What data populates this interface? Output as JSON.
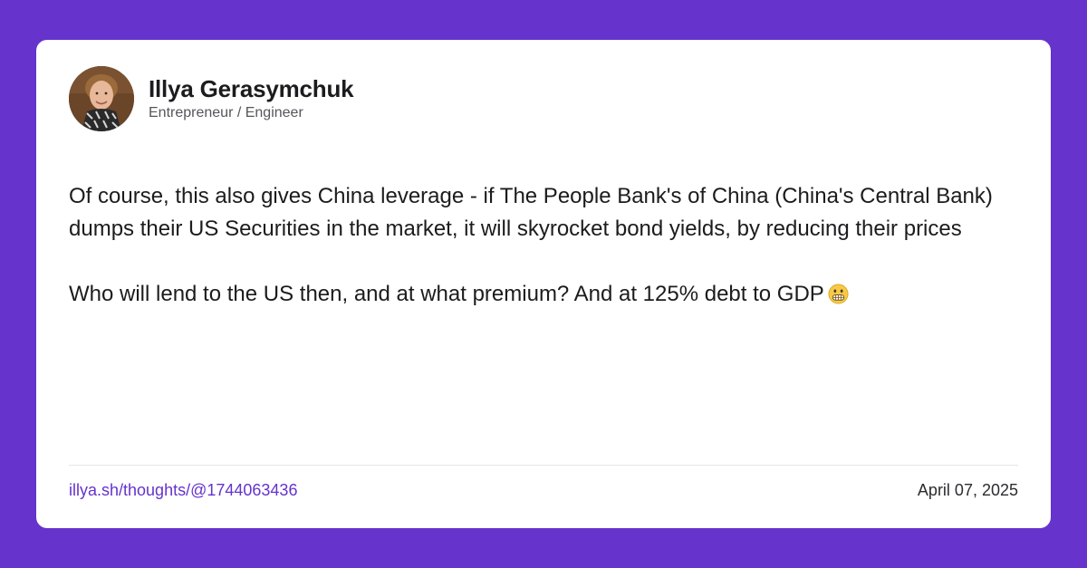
{
  "author": {
    "name": "Illya Gerasymchuk",
    "role": "Entrepreneur / Engineer",
    "avatar_icon": "profile-photo"
  },
  "post": {
    "paragraph_1": "Of course, this also gives China leverage - if The People Bank's of China (China's Central Bank) dumps their US Securities in the market, it will skyrocket bond yields, by reducing their prices",
    "paragraph_2": "Who will lend to the US then, and at what premium? And at 125% debt to GDP",
    "emoji_icon": "grimacing-face-icon"
  },
  "footer": {
    "link_text": "illya.sh/thoughts/@1744063436",
    "date": "April 07, 2025"
  },
  "colors": {
    "background": "#6633cc",
    "card": "#ffffff",
    "link": "#6633cc",
    "text": "#1c1c1e"
  }
}
